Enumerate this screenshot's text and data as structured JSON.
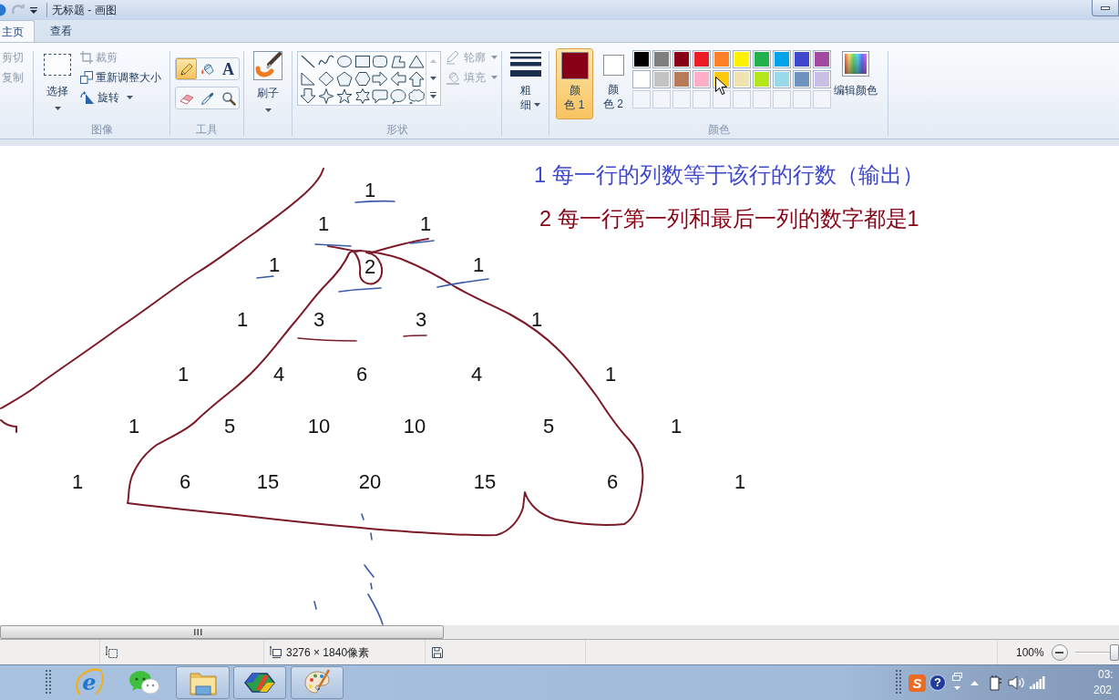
{
  "title_bar": {
    "title": "无标题 - 画图"
  },
  "tabs": [
    {
      "label": "主页",
      "selected": true
    },
    {
      "label": "查看",
      "selected": false
    }
  ],
  "ribbon": {
    "clipboard": {
      "items": [
        {
          "label": "剪切",
          "disabled": true
        },
        {
          "label": "复制",
          "disabled": true
        }
      ]
    },
    "image": {
      "label": "图像",
      "select": {
        "label": "选择"
      },
      "items": [
        {
          "label": "裁剪",
          "disabled": true
        },
        {
          "label": "重新调整大小",
          "disabled": false
        },
        {
          "label": "旋转",
          "disabled": false
        }
      ]
    },
    "tools": {
      "label": "工具",
      "items": [
        {
          "selected": true
        },
        {
          "selected": false
        },
        {
          "glyph": "A",
          "selected": false
        },
        {
          "selected": false
        },
        {
          "selected": false
        },
        {
          "selected": false
        }
      ]
    },
    "brushes": {
      "label": "刷子"
    },
    "shapes": {
      "label": "形状",
      "items": [
        {
          "label": "轮廓",
          "disabled": true
        },
        {
          "label": "填充",
          "disabled": true
        }
      ]
    },
    "size": {
      "label_lines": [
        "粗",
        "细"
      ]
    },
    "colors": {
      "label": "颜色",
      "primary": {
        "label_lines": [
          "颜",
          "色 1"
        ],
        "color": "#880015",
        "selected": true
      },
      "secondary": {
        "label_lines": [
          "颜",
          "色 2"
        ],
        "color": "#ffffff",
        "selected": false
      },
      "palette": [
        {
          "kind": "swatch",
          "color": "#000000"
        },
        {
          "kind": "swatch",
          "color": "#7f7f7f"
        },
        {
          "kind": "swatch",
          "color": "#880015"
        },
        {
          "kind": "swatch",
          "color": "#ed1c24"
        },
        {
          "kind": "swatch",
          "color": "#ff7f27"
        },
        {
          "kind": "swatch",
          "color": "#fff200"
        },
        {
          "kind": "swatch",
          "color": "#22b14c"
        },
        {
          "kind": "swatch",
          "color": "#00a2e8"
        },
        {
          "kind": "swatch",
          "color": "#3f48cc"
        },
        {
          "kind": "swatch",
          "color": "#a349a4"
        },
        {
          "kind": "swatch",
          "color": "#ffffff"
        },
        {
          "kind": "swatch",
          "color": "#c3c3c3"
        },
        {
          "kind": "swatch",
          "color": "#b97a57"
        },
        {
          "kind": "swatch",
          "color": "#ffaec9"
        },
        {
          "kind": "swatch",
          "color": "#ffc90e"
        },
        {
          "kind": "swatch",
          "color": "#efe4b0"
        },
        {
          "kind": "swatch",
          "color": "#b5e61d"
        },
        {
          "kind": "swatch",
          "color": "#99d9ea"
        },
        {
          "kind": "swatch",
          "color": "#7092be"
        },
        {
          "kind": "swatch",
          "color": "#c8bfe7"
        },
        {
          "kind": "empty"
        },
        {
          "kind": "empty"
        },
        {
          "kind": "empty"
        },
        {
          "kind": "empty"
        },
        {
          "kind": "empty"
        },
        {
          "kind": "empty"
        },
        {
          "kind": "empty"
        },
        {
          "kind": "empty"
        },
        {
          "kind": "empty"
        },
        {
          "kind": "empty"
        }
      ],
      "edit": {
        "label": "编辑颜色"
      }
    }
  },
  "canvas": {
    "notes": [
      {
        "text": "1 每一行的列数等于该行的行数（输出）",
        "color": "#3f48cc"
      },
      {
        "text": "2 每一行第一列和最后一列的数字都是1",
        "color": "#880015"
      }
    ],
    "triangle_rows": [
      [
        "1"
      ],
      [
        "1",
        "1"
      ],
      [
        "1",
        "2",
        "1"
      ],
      [
        "1",
        "3",
        "3",
        "1"
      ],
      [
        "1",
        "4",
        "6",
        "4",
        "1"
      ],
      [
        "1",
        "5",
        "10",
        "10",
        "5",
        "1"
      ],
      [
        "1",
        "6",
        "15",
        "20",
        "15",
        "6",
        "1"
      ]
    ]
  },
  "status_bar": {
    "canvas_size": "3276 × 1840像素",
    "zoom": "100%",
    "zoom_slider": {
      "level": 0.9
    }
  },
  "taskbar": {
    "apps": [
      {
        "glyph": "e",
        "open": false
      },
      {
        "open": false
      },
      {
        "open": true
      },
      {
        "open": true
      },
      {
        "open": true
      }
    ],
    "tray": {
      "input_method": "S",
      "help": "?"
    },
    "clock": {
      "time": "03:",
      "date": "202"
    }
  }
}
